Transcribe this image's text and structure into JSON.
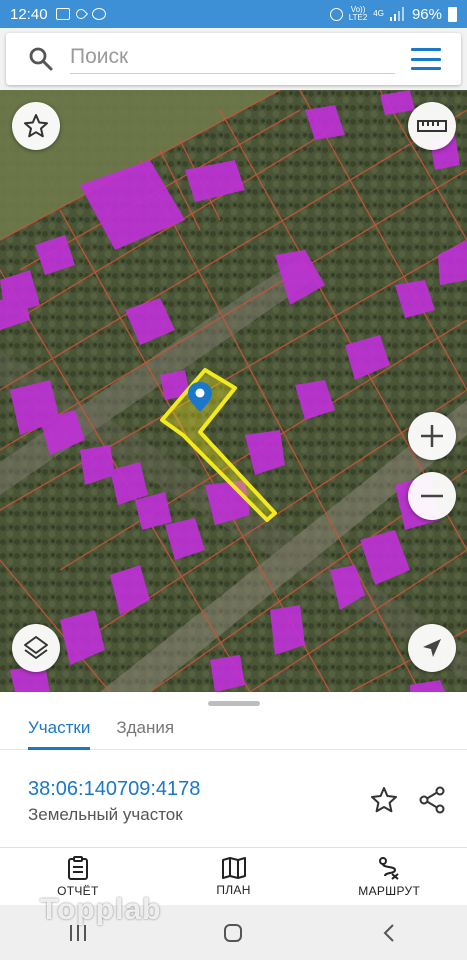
{
  "status": {
    "time": "12:40",
    "network_top": "Vo))",
    "network_bottom": "LTE2",
    "signal_type": "4G",
    "battery": "96%"
  },
  "search": {
    "placeholder": "Поиск"
  },
  "map": {
    "highlight_color": "#f2ea1d",
    "building_color": "#c030d8",
    "parcel_border_color": "#c8553a"
  },
  "sheet": {
    "tabs": [
      {
        "label": "Участки",
        "active": true
      },
      {
        "label": "Здания",
        "active": false
      }
    ],
    "parcel_id": "38:06:140709:4178",
    "parcel_type": "Земельный участок"
  },
  "nav": {
    "report_label": "ОТЧЁТ",
    "plan_label": "ПЛАН",
    "route_label": "МАРШРУТ"
  },
  "watermark": "Topplab",
  "colors": {
    "accent": "#1b77c9",
    "status_bar": "#3d8fd6"
  }
}
